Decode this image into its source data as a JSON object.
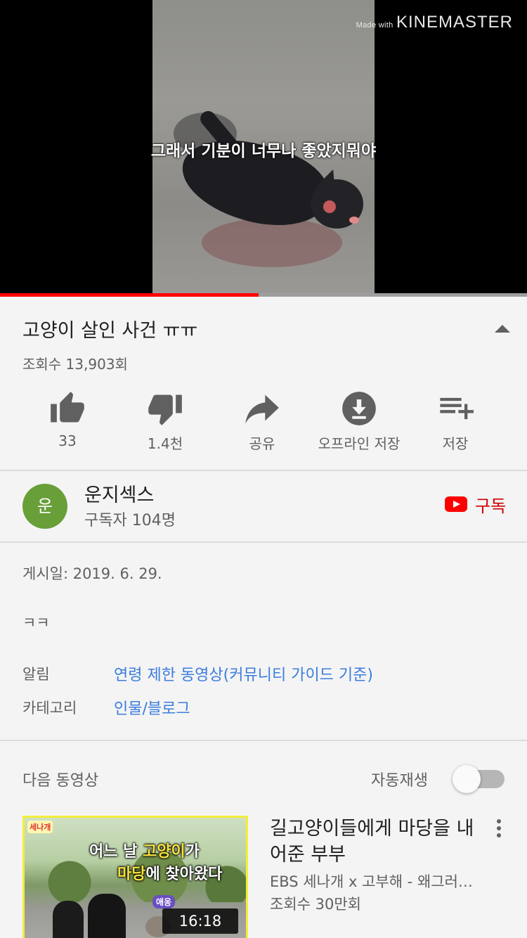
{
  "player": {
    "watermark_prefix": "Made with",
    "watermark_brand": "KINEMASTER",
    "subtitle": "그래서 기분이 너무나 좋았지뭐야",
    "progress": 0.49
  },
  "video": {
    "title": "고양이 살인 사건 ㅠㅠ",
    "views": "조회수 13,903회"
  },
  "actions": [
    {
      "icon": "thumbs-up-icon",
      "label": "33"
    },
    {
      "icon": "thumbs-down-icon",
      "label": "1.4천"
    },
    {
      "icon": "share-icon",
      "label": "공유"
    },
    {
      "icon": "download-icon",
      "label": "오프라인 저장"
    },
    {
      "icon": "add-to-playlist-icon",
      "label": "저장"
    }
  ],
  "channel": {
    "avatar_letter": "운",
    "avatar_color": "#689f38",
    "name": "운지섹스",
    "subscribers": "구독자 104명",
    "subscribe_label": "구독"
  },
  "description": {
    "posted": "게시일: 2019. 6. 29.",
    "body": "ㅋㅋ",
    "notice_key": "알림",
    "notice_value": "연령 제한 동영상(커뮤니티 가이드 기준)",
    "category_key": "카테고리",
    "category_value": "인물/블로그"
  },
  "up_next": {
    "heading": "다음 동영상",
    "autoplay_label": "자동재생",
    "autoplay_on": false
  },
  "next_video": {
    "thumb_text_line1_a": "어느 날 ",
    "thumb_text_line1_b": "고양이",
    "thumb_text_line1_c": "가",
    "thumb_text_line2_a": "마당",
    "thumb_text_line2_b": "에 찾아왔다",
    "thumb_sticker": "애옹",
    "thumb_logo": "세나개",
    "duration": "16:18",
    "title": "길고양이들에게 마당을 내어준 부부",
    "channel": "EBS 세나개 x 고부해 - 왜그러…",
    "views": "조회수 30만회"
  },
  "colors": {
    "accent_red": "#ff0000",
    "link_blue": "#3b7ddd",
    "background": "#f4f4f4"
  }
}
